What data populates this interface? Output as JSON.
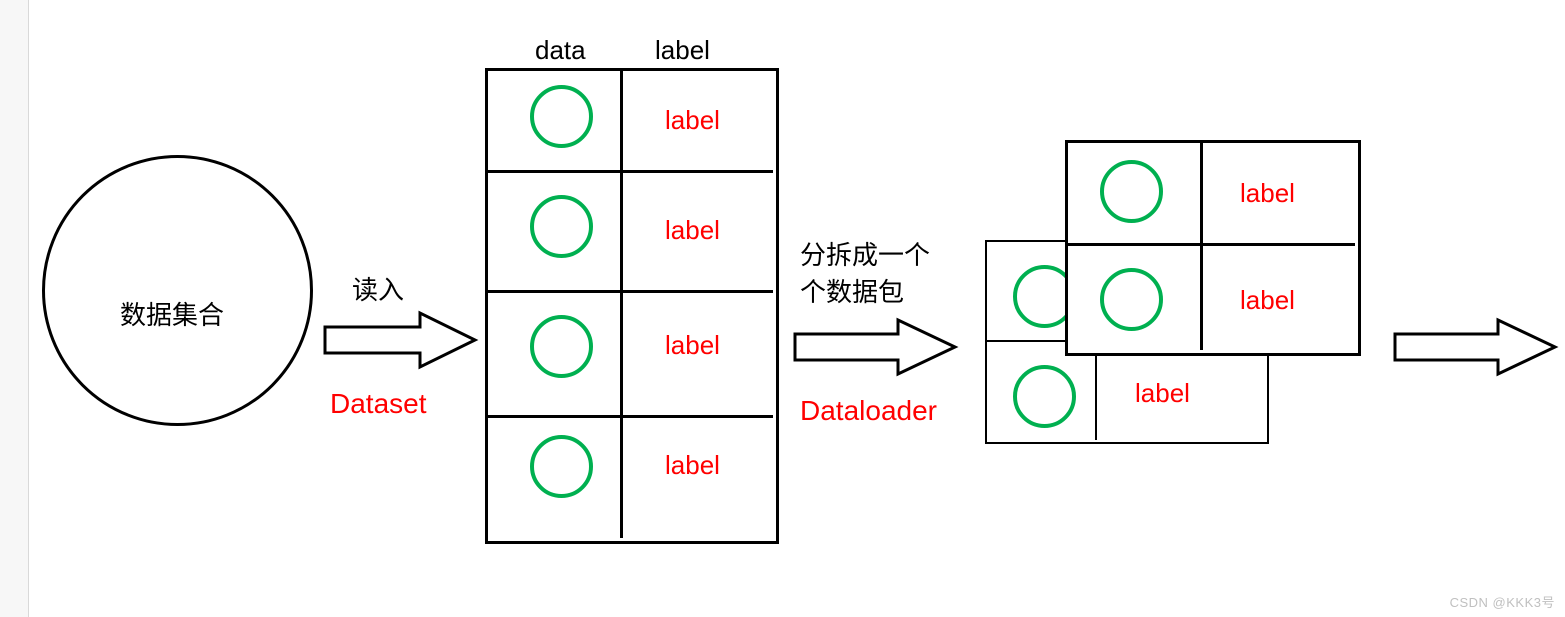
{
  "dataset_circle": {
    "label": "数据集合"
  },
  "arrow1": {
    "top_label": "读入",
    "bottom_label": "Dataset"
  },
  "table": {
    "headers": {
      "col1": "data",
      "col2": "label"
    },
    "rows": [
      {
        "label": "label"
      },
      {
        "label": "label"
      },
      {
        "label": "label"
      },
      {
        "label": "label"
      }
    ]
  },
  "arrow2": {
    "top_line1": "分拆成一个",
    "top_line2": "个数据包",
    "bottom_label": "Dataloader"
  },
  "batches": {
    "back_rows": [
      {
        "label": ""
      },
      {
        "label": "label"
      }
    ],
    "front_rows": [
      {
        "label": "label"
      },
      {
        "label": "label"
      }
    ]
  },
  "watermark": "CSDN @KKK3号"
}
